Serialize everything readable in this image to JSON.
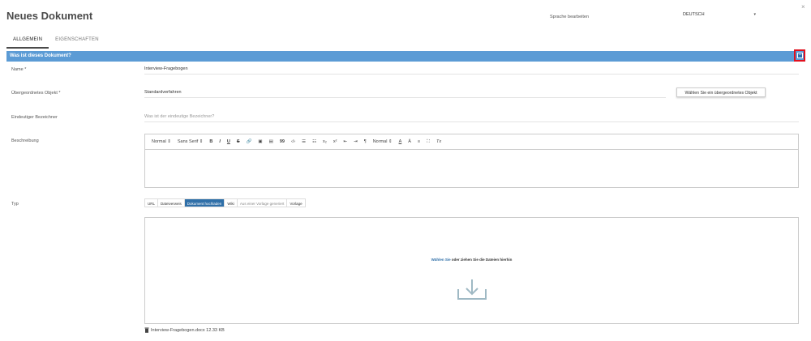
{
  "header": {
    "title": "Neues Dokument",
    "close_glyph": "×",
    "language_label": "Sprache bearbeiten",
    "language_value": "DEUTSCH",
    "language_caret": "▾"
  },
  "tabs": [
    {
      "label": "ALLGEMEIN",
      "active": true
    },
    {
      "label": "EIGENSCHAFTEN",
      "active": false
    }
  ],
  "section": {
    "title": "Was ist dieses Dokument?",
    "collapse_glyph": "–"
  },
  "form": {
    "name_label": "Name *",
    "name_value": "Interview-Fragebogen",
    "parent_label": "Übergeordnetes Objekt *",
    "parent_value": "Standardverfahren",
    "parent_button": "Wählen Sie ein übergeordnetes Objekt",
    "identifier_label": "Eindeutiger Bezeichner",
    "identifier_placeholder": "Was ist der eindeutige Bezeichner?",
    "description_label": "Beschreibung",
    "type_label": "Typ"
  },
  "editor_toolbar": {
    "heading": "Normal",
    "heading_caret": "⇕",
    "font": "Sans Serif",
    "font_caret": "⇕",
    "bold": "B",
    "italic": "I",
    "underline": "U",
    "strike": "S",
    "link": "🔗",
    "image": "▣",
    "video": "▤",
    "blockquote": "99",
    "code": "‹/›",
    "ordered_list": "☰",
    "bullet_list": "☷",
    "subscript": "x₂",
    "superscript": "x²",
    "outdent": "⇤",
    "indent": "⇥",
    "direction": "¶",
    "size": "Normal",
    "size_caret": "⇕",
    "color": "A",
    "background": "Ā",
    "align": "≡",
    "fullscreen": "⛶",
    "clean": "Tx"
  },
  "type_options": [
    {
      "label": "URL",
      "state": "normal"
    },
    {
      "label": "Dateiverweis",
      "state": "normal"
    },
    {
      "label": "Dokument hochladen",
      "state": "active"
    },
    {
      "label": "Wiki",
      "state": "normal"
    },
    {
      "label": "Aus einer Vorlage generiert",
      "state": "muted"
    },
    {
      "label": "Vorlage",
      "state": "normal"
    }
  ],
  "dropzone": {
    "link_text": "Wählen Sie",
    "rest_text": " oder ziehen Sie die Dateien hierhin",
    "icon": "download-icon"
  },
  "file": {
    "name": "Interview-Fragebogen.docx 12.33 KB",
    "icon": "trash-icon"
  },
  "colors": {
    "section_bar": "#5b9bd5",
    "active_type": "#2f6fa8",
    "highlight": "#e0101e",
    "dropzone_icon": "#9fb9c4"
  }
}
